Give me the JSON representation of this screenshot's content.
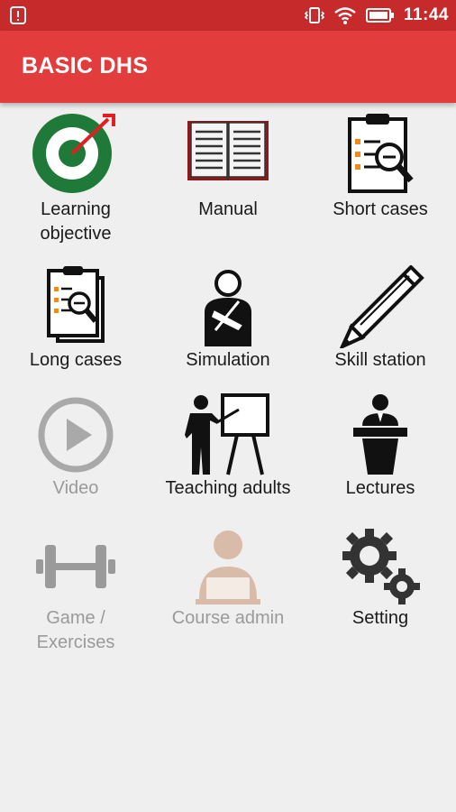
{
  "status_bar": {
    "time": "11:44",
    "icons": [
      "alert-icon",
      "vibrate-icon",
      "wifi-icon",
      "battery-icon"
    ]
  },
  "app_bar": {
    "title": "BASIC DHS"
  },
  "menu": [
    {
      "label": "Learning\nobjective",
      "icon": "target-icon",
      "enabled": true
    },
    {
      "label": "Manual",
      "icon": "book-icon",
      "enabled": true
    },
    {
      "label": "Short cases",
      "icon": "clipboard-search-icon",
      "enabled": true
    },
    {
      "label": "Long cases",
      "icon": "clipboard-stack-icon",
      "enabled": true
    },
    {
      "label": "Simulation",
      "icon": "patient-sling-icon",
      "enabled": true
    },
    {
      "label": "Skill station",
      "icon": "pencil-icon",
      "enabled": true
    },
    {
      "label": "Video",
      "icon": "play-icon",
      "enabled": false
    },
    {
      "label": "Teaching adults",
      "icon": "teacher-board-icon",
      "enabled": true
    },
    {
      "label": "Lectures",
      "icon": "lecturer-podium-icon",
      "enabled": true
    },
    {
      "label": "Game /\nExercises",
      "icon": "dumbbell-icon",
      "enabled": false
    },
    {
      "label": "Course admin",
      "icon": "admin-person-icon",
      "enabled": false
    },
    {
      "label": "Setting",
      "icon": "gears-icon",
      "enabled": true
    }
  ],
  "colors": {
    "status_bar": "#c62a2a",
    "app_bar": "#e23c3c",
    "background": "#efefef",
    "disabled_text": "#9a9a9a"
  }
}
